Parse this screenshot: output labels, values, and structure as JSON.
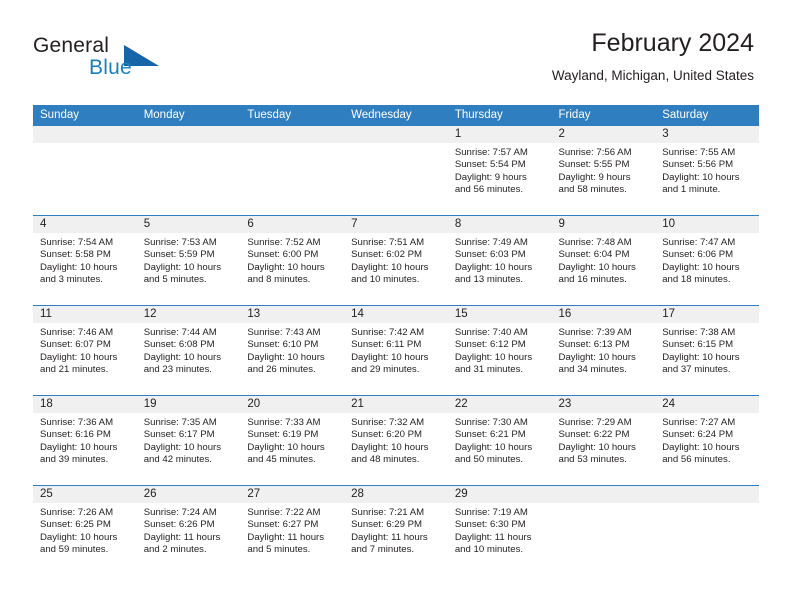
{
  "brand": {
    "name_general": "General",
    "name_blue": "Blue",
    "logo_icon": "triangle-icon",
    "accent_color": "#1565a8"
  },
  "header": {
    "title": "February 2024",
    "subtitle": "Wayland, Michigan, United States"
  },
  "theme": {
    "header_row_color": "#2f7ec0",
    "day_band_color": "#f0f0f0",
    "text_color": "#231f20"
  },
  "weekdays": [
    "Sunday",
    "Monday",
    "Tuesday",
    "Wednesday",
    "Thursday",
    "Friday",
    "Saturday"
  ],
  "labels": {
    "sunrise": "Sunrise:",
    "sunset": "Sunset:",
    "daylight": "Daylight:"
  },
  "weeks": [
    [
      {
        "day": "",
        "blank": true
      },
      {
        "day": "",
        "blank": true
      },
      {
        "day": "",
        "blank": true
      },
      {
        "day": "",
        "blank": true
      },
      {
        "day": "1",
        "sunrise": "Sunrise: 7:57 AM",
        "sunset": "Sunset: 5:54 PM",
        "daylight_1": "Daylight: 9 hours",
        "daylight_2": "and 56 minutes."
      },
      {
        "day": "2",
        "sunrise": "Sunrise: 7:56 AM",
        "sunset": "Sunset: 5:55 PM",
        "daylight_1": "Daylight: 9 hours",
        "daylight_2": "and 58 minutes."
      },
      {
        "day": "3",
        "sunrise": "Sunrise: 7:55 AM",
        "sunset": "Sunset: 5:56 PM",
        "daylight_1": "Daylight: 10 hours",
        "daylight_2": "and 1 minute."
      }
    ],
    [
      {
        "day": "4",
        "sunrise": "Sunrise: 7:54 AM",
        "sunset": "Sunset: 5:58 PM",
        "daylight_1": "Daylight: 10 hours",
        "daylight_2": "and 3 minutes."
      },
      {
        "day": "5",
        "sunrise": "Sunrise: 7:53 AM",
        "sunset": "Sunset: 5:59 PM",
        "daylight_1": "Daylight: 10 hours",
        "daylight_2": "and 5 minutes."
      },
      {
        "day": "6",
        "sunrise": "Sunrise: 7:52 AM",
        "sunset": "Sunset: 6:00 PM",
        "daylight_1": "Daylight: 10 hours",
        "daylight_2": "and 8 minutes."
      },
      {
        "day": "7",
        "sunrise": "Sunrise: 7:51 AM",
        "sunset": "Sunset: 6:02 PM",
        "daylight_1": "Daylight: 10 hours",
        "daylight_2": "and 10 minutes."
      },
      {
        "day": "8",
        "sunrise": "Sunrise: 7:49 AM",
        "sunset": "Sunset: 6:03 PM",
        "daylight_1": "Daylight: 10 hours",
        "daylight_2": "and 13 minutes."
      },
      {
        "day": "9",
        "sunrise": "Sunrise: 7:48 AM",
        "sunset": "Sunset: 6:04 PM",
        "daylight_1": "Daylight: 10 hours",
        "daylight_2": "and 16 minutes."
      },
      {
        "day": "10",
        "sunrise": "Sunrise: 7:47 AM",
        "sunset": "Sunset: 6:06 PM",
        "daylight_1": "Daylight: 10 hours",
        "daylight_2": "and 18 minutes."
      }
    ],
    [
      {
        "day": "11",
        "sunrise": "Sunrise: 7:46 AM",
        "sunset": "Sunset: 6:07 PM",
        "daylight_1": "Daylight: 10 hours",
        "daylight_2": "and 21 minutes."
      },
      {
        "day": "12",
        "sunrise": "Sunrise: 7:44 AM",
        "sunset": "Sunset: 6:08 PM",
        "daylight_1": "Daylight: 10 hours",
        "daylight_2": "and 23 minutes."
      },
      {
        "day": "13",
        "sunrise": "Sunrise: 7:43 AM",
        "sunset": "Sunset: 6:10 PM",
        "daylight_1": "Daylight: 10 hours",
        "daylight_2": "and 26 minutes."
      },
      {
        "day": "14",
        "sunrise": "Sunrise: 7:42 AM",
        "sunset": "Sunset: 6:11 PM",
        "daylight_1": "Daylight: 10 hours",
        "daylight_2": "and 29 minutes."
      },
      {
        "day": "15",
        "sunrise": "Sunrise: 7:40 AM",
        "sunset": "Sunset: 6:12 PM",
        "daylight_1": "Daylight: 10 hours",
        "daylight_2": "and 31 minutes."
      },
      {
        "day": "16",
        "sunrise": "Sunrise: 7:39 AM",
        "sunset": "Sunset: 6:13 PM",
        "daylight_1": "Daylight: 10 hours",
        "daylight_2": "and 34 minutes."
      },
      {
        "day": "17",
        "sunrise": "Sunrise: 7:38 AM",
        "sunset": "Sunset: 6:15 PM",
        "daylight_1": "Daylight: 10 hours",
        "daylight_2": "and 37 minutes."
      }
    ],
    [
      {
        "day": "18",
        "sunrise": "Sunrise: 7:36 AM",
        "sunset": "Sunset: 6:16 PM",
        "daylight_1": "Daylight: 10 hours",
        "daylight_2": "and 39 minutes."
      },
      {
        "day": "19",
        "sunrise": "Sunrise: 7:35 AM",
        "sunset": "Sunset: 6:17 PM",
        "daylight_1": "Daylight: 10 hours",
        "daylight_2": "and 42 minutes."
      },
      {
        "day": "20",
        "sunrise": "Sunrise: 7:33 AM",
        "sunset": "Sunset: 6:19 PM",
        "daylight_1": "Daylight: 10 hours",
        "daylight_2": "and 45 minutes."
      },
      {
        "day": "21",
        "sunrise": "Sunrise: 7:32 AM",
        "sunset": "Sunset: 6:20 PM",
        "daylight_1": "Daylight: 10 hours",
        "daylight_2": "and 48 minutes."
      },
      {
        "day": "22",
        "sunrise": "Sunrise: 7:30 AM",
        "sunset": "Sunset: 6:21 PM",
        "daylight_1": "Daylight: 10 hours",
        "daylight_2": "and 50 minutes."
      },
      {
        "day": "23",
        "sunrise": "Sunrise: 7:29 AM",
        "sunset": "Sunset: 6:22 PM",
        "daylight_1": "Daylight: 10 hours",
        "daylight_2": "and 53 minutes."
      },
      {
        "day": "24",
        "sunrise": "Sunrise: 7:27 AM",
        "sunset": "Sunset: 6:24 PM",
        "daylight_1": "Daylight: 10 hours",
        "daylight_2": "and 56 minutes."
      }
    ],
    [
      {
        "day": "25",
        "sunrise": "Sunrise: 7:26 AM",
        "sunset": "Sunset: 6:25 PM",
        "daylight_1": "Daylight: 10 hours",
        "daylight_2": "and 59 minutes."
      },
      {
        "day": "26",
        "sunrise": "Sunrise: 7:24 AM",
        "sunset": "Sunset: 6:26 PM",
        "daylight_1": "Daylight: 11 hours",
        "daylight_2": "and 2 minutes."
      },
      {
        "day": "27",
        "sunrise": "Sunrise: 7:22 AM",
        "sunset": "Sunset: 6:27 PM",
        "daylight_1": "Daylight: 11 hours",
        "daylight_2": "and 5 minutes."
      },
      {
        "day": "28",
        "sunrise": "Sunrise: 7:21 AM",
        "sunset": "Sunset: 6:29 PM",
        "daylight_1": "Daylight: 11 hours",
        "daylight_2": "and 7 minutes."
      },
      {
        "day": "29",
        "sunrise": "Sunrise: 7:19 AM",
        "sunset": "Sunset: 6:30 PM",
        "daylight_1": "Daylight: 11 hours",
        "daylight_2": "and 10 minutes."
      },
      {
        "day": "",
        "blank": true
      },
      {
        "day": "",
        "blank": true
      }
    ]
  ]
}
